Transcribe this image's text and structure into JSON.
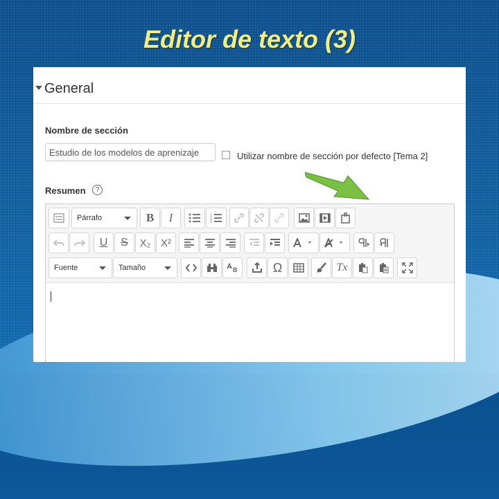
{
  "slide": {
    "title": "Editor de texto (3)"
  },
  "section": {
    "heading": "General",
    "name_label": "Nombre de sección",
    "name_value": "Estudio de los modelos de aprenizaje",
    "default_label": "Utilizar nombre de sección por defecto [Tema 2]",
    "summary_label": "Resumen",
    "help": "?"
  },
  "toolbar": {
    "format_select": "Párrafo",
    "font_select": "Fuente",
    "size_select": "Tamaño",
    "bold": "B",
    "italic": "I",
    "underline": "U",
    "strike": "S",
    "subscript": "X₂",
    "superscript": "X²",
    "omega": "Ω",
    "clear_format": "Tx"
  },
  "colors": {
    "title": "#f4ef7a",
    "arrow": "#7ac143",
    "background": "#0d5c9e"
  }
}
